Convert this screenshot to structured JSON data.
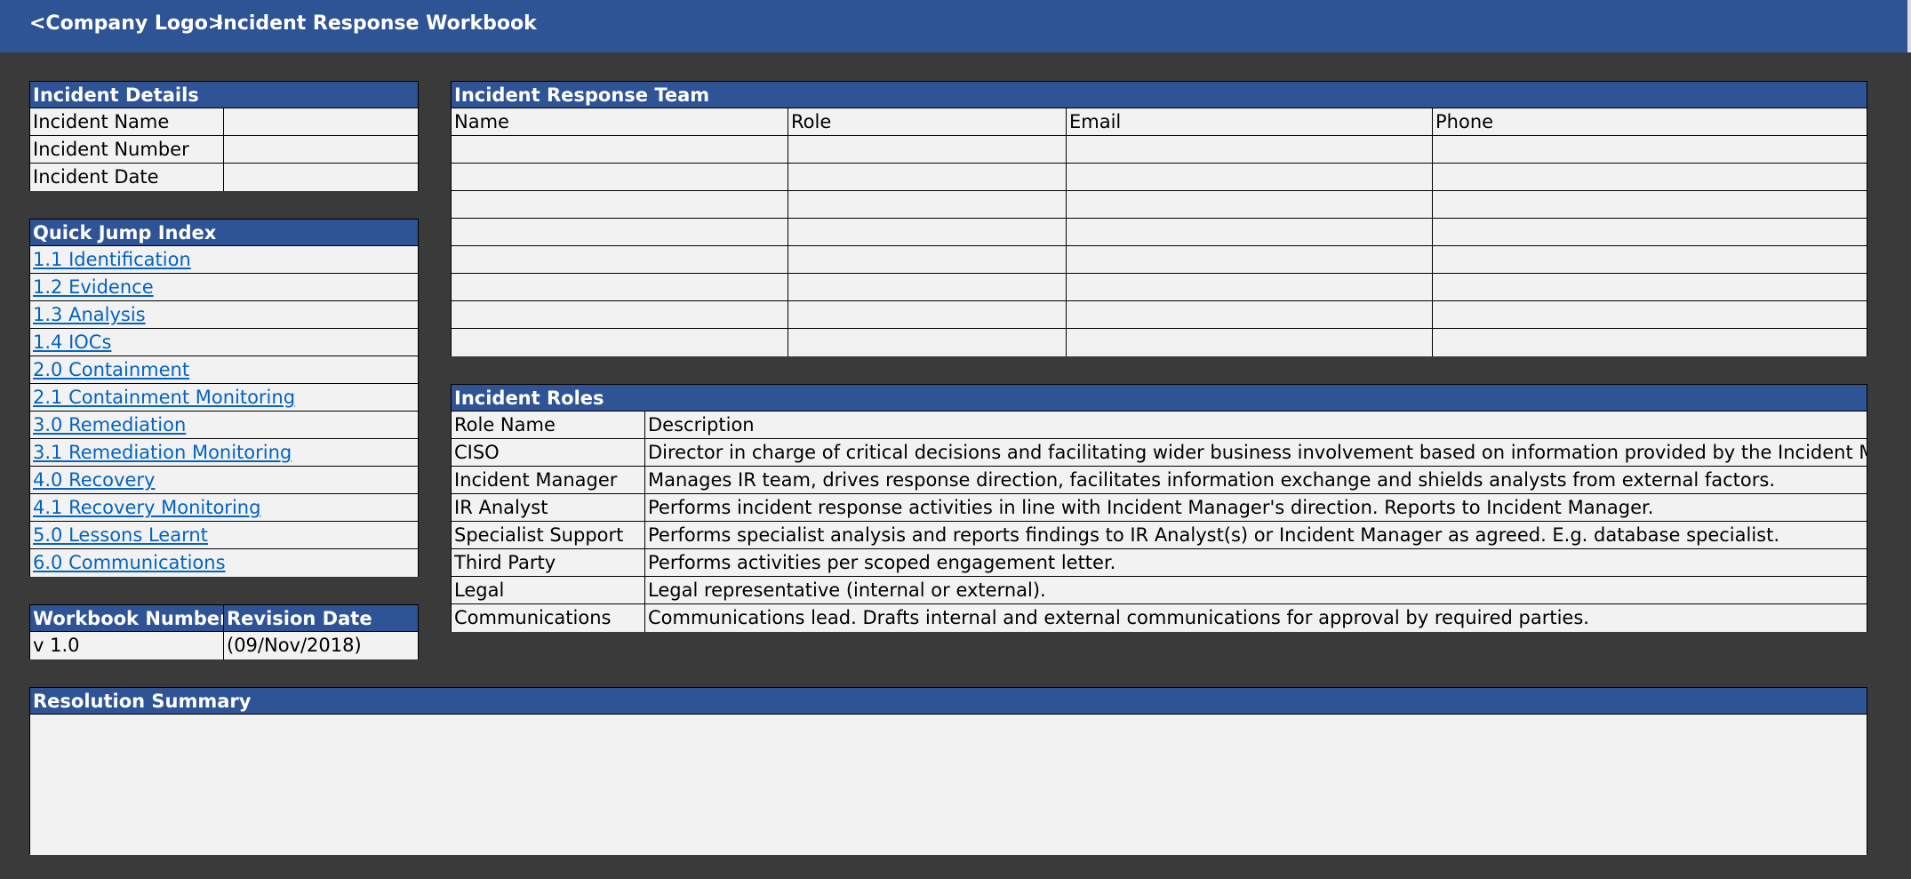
{
  "header": {
    "logo": "<Company Logo>",
    "title": "Incident Response Workbook"
  },
  "incident_details": {
    "title": "Incident Details",
    "rows": [
      {
        "label": "Incident Name",
        "value": ""
      },
      {
        "label": "Incident Number",
        "value": ""
      },
      {
        "label": "Incident Date",
        "value": ""
      }
    ]
  },
  "quick_jump": {
    "title": "Quick Jump Index",
    "links": [
      "1.1 Identification",
      "1.2 Evidence",
      "1.3 Analysis",
      "1.4 IOCs",
      "2.0 Containment",
      "2.1 Containment Monitoring",
      "3.0 Remediation",
      "3.1 Remediation Monitoring",
      "4.0 Recovery",
      "4.1 Recovery Monitoring",
      "5.0 Lessons Learnt",
      "6.0 Communications"
    ]
  },
  "workbook": {
    "number_label": "Workbook Number",
    "date_label": "Revision Date",
    "number": "v 1.0",
    "date": "(09/Nov/2018)"
  },
  "team": {
    "title": "Incident Response Team",
    "columns": [
      "Name",
      "Role",
      "Email",
      "Phone"
    ],
    "rows": [
      [
        "",
        "",
        "",
        ""
      ],
      [
        "",
        "",
        "",
        ""
      ],
      [
        "",
        "",
        "",
        ""
      ],
      [
        "",
        "",
        "",
        ""
      ],
      [
        "",
        "",
        "",
        ""
      ],
      [
        "",
        "",
        "",
        ""
      ],
      [
        "",
        "",
        "",
        ""
      ],
      [
        "",
        "",
        "",
        ""
      ]
    ]
  },
  "roles": {
    "title": "Incident Roles",
    "columns": [
      "Role Name",
      "Description"
    ],
    "rows": [
      [
        "CISO",
        "Director in charge of critical decisions and facilitating wider business involvement based on information provided by the Incident Manager."
      ],
      [
        "Incident Manager",
        "Manages IR team, drives response direction, facilitates information exchange and shields analysts from external factors."
      ],
      [
        "IR Analyst",
        "Performs incident response activities in line with Incident Manager's direction. Reports to Incident Manager."
      ],
      [
        "Specialist Support",
        "Performs specialist analysis and reports findings to IR Analyst(s) or Incident Manager as agreed. E.g. database specialist."
      ],
      [
        "Third Party",
        "Performs activities per scoped engagement letter."
      ],
      [
        "Legal",
        "Legal representative (internal or external)."
      ],
      [
        "Communications",
        "Communications lead. Drafts internal and external communications for approval by required parties."
      ]
    ]
  },
  "resolution": {
    "title": "Resolution Summary",
    "text": ""
  }
}
